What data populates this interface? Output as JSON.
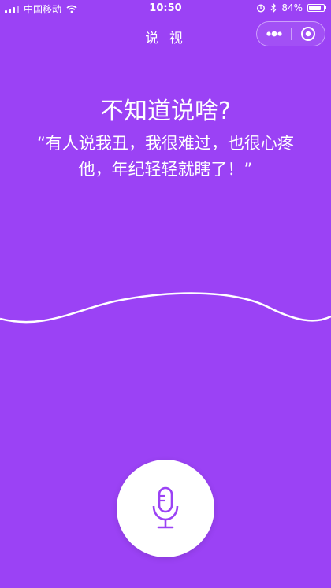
{
  "status_bar": {
    "carrier": "中国移动",
    "time": "10:50",
    "battery_percent_label": "84%",
    "battery_level": 0.84,
    "icons": [
      "signal-icon",
      "wifi-icon",
      "alarm-icon",
      "bluetooth-icon",
      "battery-icon"
    ]
  },
  "nav": {
    "title": "说 视",
    "more_icon": "more-dots-icon",
    "close_icon": "target-circle-icon"
  },
  "main": {
    "heading": "不知道说啥?",
    "quote_line1": "“有人说我丑，我很难过，也很心疼",
    "quote_line2": "他，年纪轻轻就瞎了！”"
  },
  "mic": {
    "icon": "microphone-icon"
  },
  "colors": {
    "background": "#9b42f5",
    "accent": "#9b42f5",
    "text": "#ffffff",
    "button": "#ffffff"
  }
}
